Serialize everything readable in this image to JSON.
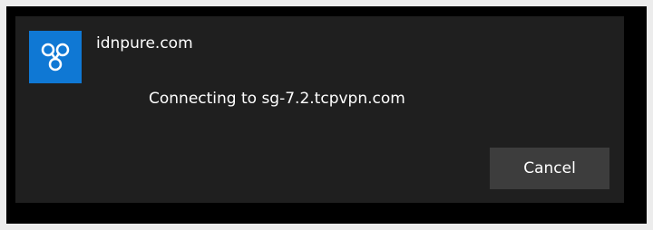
{
  "dialog": {
    "app_name": "idnpure.com",
    "status_text": "Connecting to sg-7.2.tcpvpn.com",
    "cancel_label": "Cancel"
  },
  "icon": {
    "name": "vpn-app-icon",
    "background_color": "#0f78d4"
  },
  "colors": {
    "dialog_background": "#1f1f1f",
    "button_background": "#3d3d3d",
    "text": "#ffffff"
  }
}
